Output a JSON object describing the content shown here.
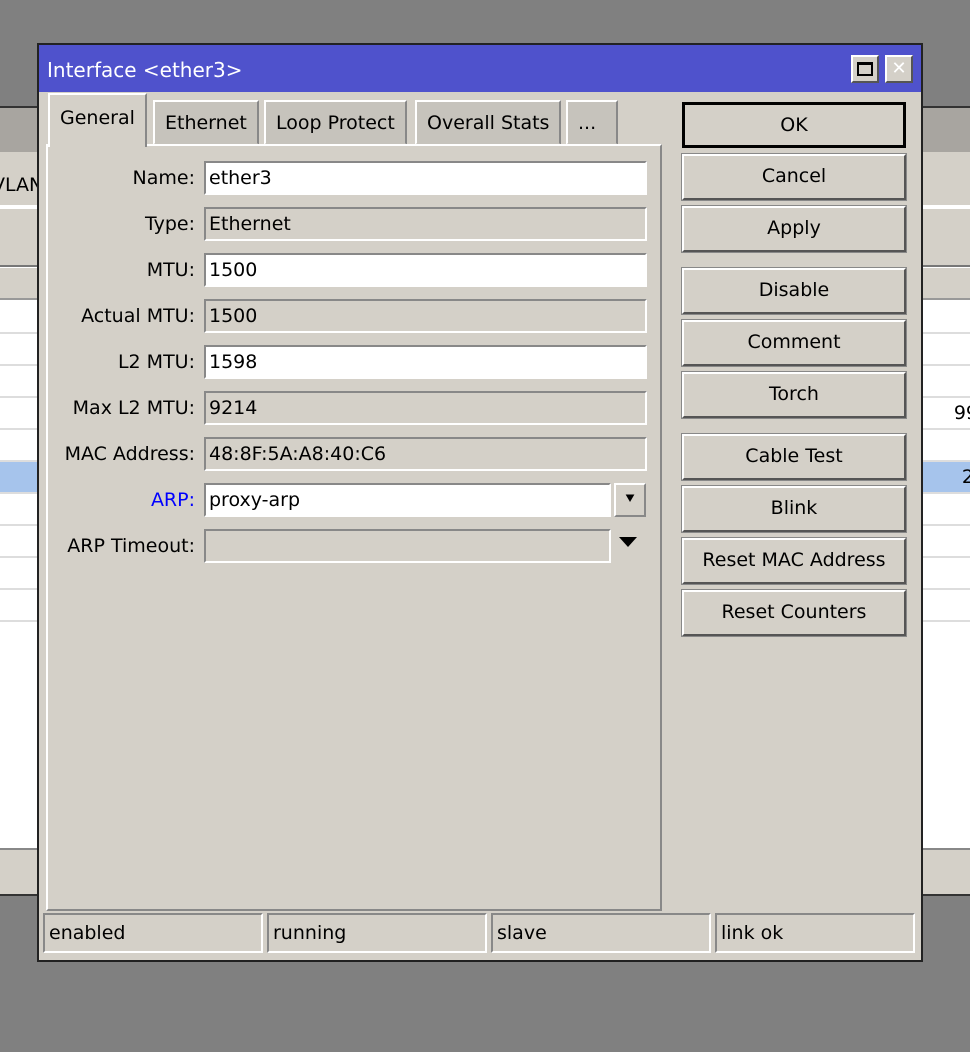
{
  "background": {
    "tab_label": "VLAN",
    "cell_1": "99",
    "cell_2": "2"
  },
  "window": {
    "title": "Interface <ether3>",
    "maximize_icon": "square",
    "close_icon": "x"
  },
  "tabs": [
    {
      "label": "General",
      "active": true
    },
    {
      "label": "Ethernet"
    },
    {
      "label": "Loop Protect"
    },
    {
      "label": "Overall Stats"
    },
    {
      "label": "..."
    }
  ],
  "fields": {
    "name": {
      "label": "Name:",
      "value": "ether3"
    },
    "type": {
      "label": "Type:",
      "value": "Ethernet"
    },
    "mtu": {
      "label": "MTU:",
      "value": "1500"
    },
    "actual_mtu": {
      "label": "Actual MTU:",
      "value": "1500"
    },
    "l2_mtu": {
      "label": "L2 MTU:",
      "value": "1598"
    },
    "max_l2_mtu": {
      "label": "Max L2 MTU:",
      "value": "9214"
    },
    "mac": {
      "label": "MAC Address:",
      "value": "48:8F:5A:A8:40:C6"
    },
    "arp": {
      "label": "ARP:",
      "value": "proxy-arp"
    },
    "arp_timeout": {
      "label": "ARP Timeout:",
      "value": ""
    }
  },
  "buttons": [
    "OK",
    "Cancel",
    "Apply",
    "Disable",
    "Comment",
    "Torch",
    "Cable Test",
    "Blink",
    "Reset MAC Address",
    "Reset Counters"
  ],
  "status": [
    "enabled",
    "running",
    "slave",
    "link ok"
  ],
  "colors": {
    "titlebar": "#4f52cc",
    "arp_label": "#0000ff",
    "selected_row": "#a6c4ec"
  }
}
